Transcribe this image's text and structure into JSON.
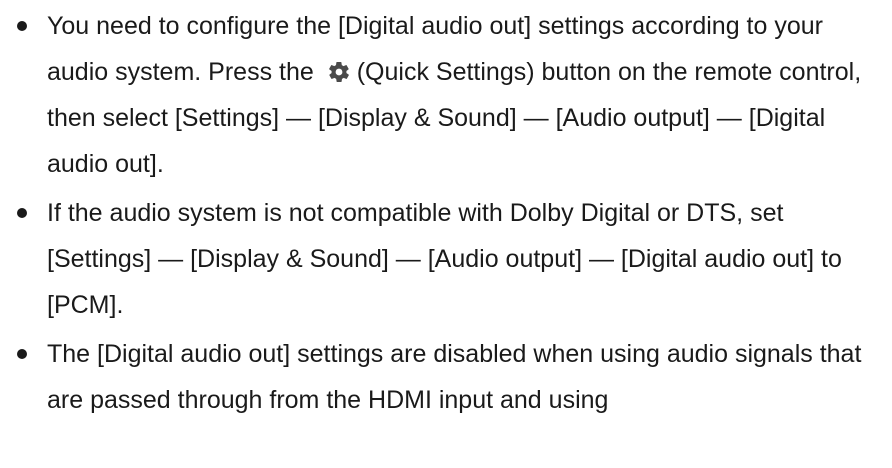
{
  "bullets": [
    {
      "text_before_icon": "You need to configure the [Digital audio out] settings according to your audio system. Press the",
      "icon": "gear-icon",
      "text_after_icon": "(Quick Settings) button on the remote control, then select [Settings] — [Display & Sound] — [Audio output] — [Digital audio out]."
    },
    {
      "text": "If the audio system is not compatible with Dolby Digital or DTS, set [Settings] — [Display & Sound] — [Audio output] — [Digital audio out] to [PCM]."
    },
    {
      "text": "The [Digital audio out] settings are disabled when using audio signals that are passed through from the HDMI input and using"
    }
  ],
  "colors": {
    "text": "#1a1a1a",
    "icon_bg": "#4a4a4a",
    "icon_fg": "#ffffff"
  }
}
